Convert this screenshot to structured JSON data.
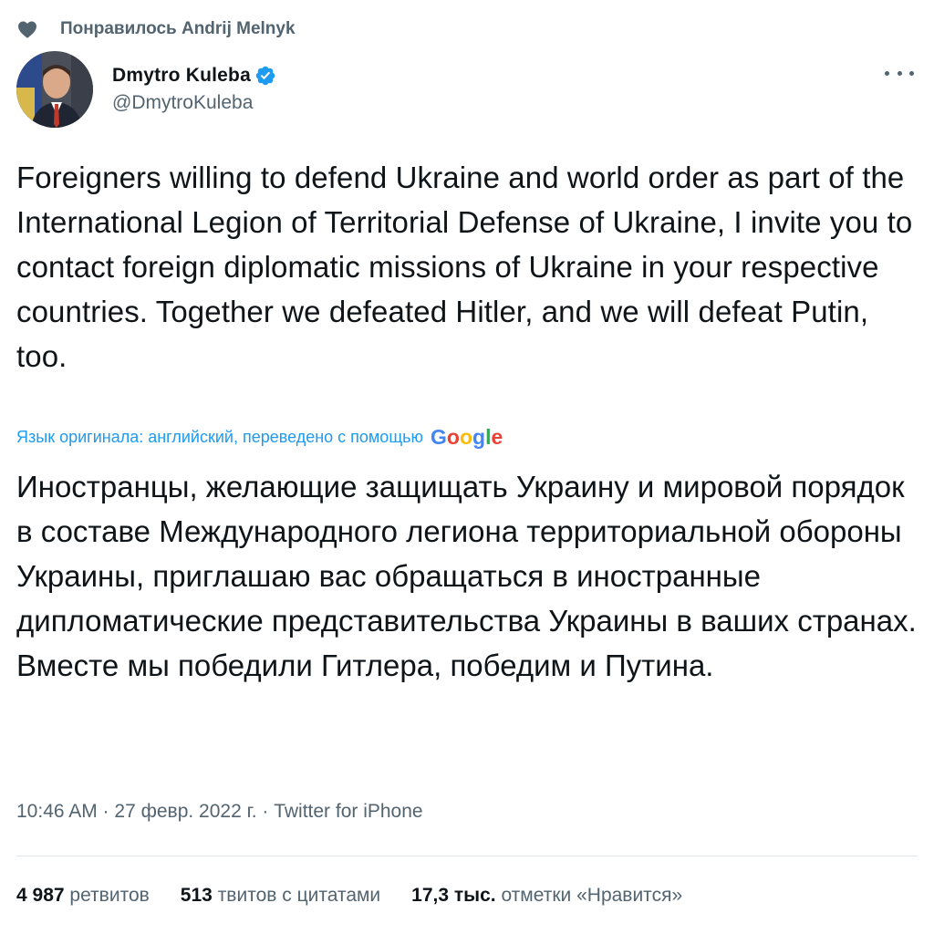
{
  "social_context": {
    "icon": "heart-icon",
    "text": "Понравилось Andrij Melnyk"
  },
  "author": {
    "display_name": "Dmytro Kuleba",
    "handle": "@DmytroKuleba",
    "verified_icon": "verified-badge-icon"
  },
  "tweet": {
    "text": "Foreigners willing to defend Ukraine and world order as part of the International Legion of Territorial Defense of Ukraine, I invite you to contact foreign diplomatic missions of Ukraine in your respective countries. Together we defeated Hitler, and we will defeat Putin, too.",
    "translation_note": "Язык оригинала: английский, переведено с помощью",
    "translation_provider": "Google",
    "translated_text": "Иностранцы, желающие защищать Украину и мировой порядок в составе Международного легиона территориальной обороны Украины, приглашаю вас обращаться в иностранные дипломатические представительства Украины в ваших странах. Вместе мы победили Гитлера, победим и Путина."
  },
  "meta": {
    "text": "10:46 AM · 27 февр. 2022 г. · Twitter for iPhone"
  },
  "stats": [
    {
      "count": "4 987",
      "label": "ретвитов"
    },
    {
      "count": "513",
      "label": "твитов с цитатами"
    },
    {
      "count": "17,3 тыс.",
      "label": "отметки «Нравится»"
    }
  ],
  "colors": {
    "accent": "#1d9bf0",
    "secondary_text": "#536471",
    "primary_text": "#0f1419"
  }
}
